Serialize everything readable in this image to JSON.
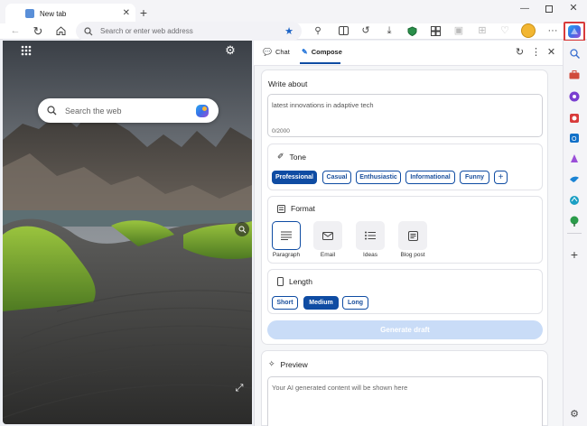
{
  "tab": {
    "title": "New tab"
  },
  "address_bar": {
    "placeholder": "Search or enter web address"
  },
  "newtab": {
    "search_placeholder": "Search the web"
  },
  "copilot": {
    "tabs": [
      {
        "label": "Chat"
      },
      {
        "label": "Compose"
      }
    ],
    "active_tab": "Compose",
    "write_about": {
      "title": "Write about",
      "value": "latest innovations in adaptive tech",
      "counter": "0/2000"
    },
    "tone": {
      "title": "Tone",
      "options": [
        "Professional",
        "Casual",
        "Enthusiastic",
        "Informational",
        "Funny"
      ],
      "selected": "Professional",
      "add_label": "+"
    },
    "format": {
      "title": "Format",
      "options": [
        "Paragraph",
        "Email",
        "Ideas",
        "Blog post"
      ],
      "selected": "Paragraph"
    },
    "length": {
      "title": "Length",
      "options": [
        "Short",
        "Medium",
        "Long"
      ],
      "selected": "Medium"
    },
    "generate_label": "Generate draft",
    "preview": {
      "title": "Preview",
      "placeholder": "Your AI generated content will be shown here"
    }
  },
  "colors": {
    "accent": "#0f4ca3",
    "generate_bg": "#c9dcf7",
    "highlight_box": "#d83b3b"
  }
}
